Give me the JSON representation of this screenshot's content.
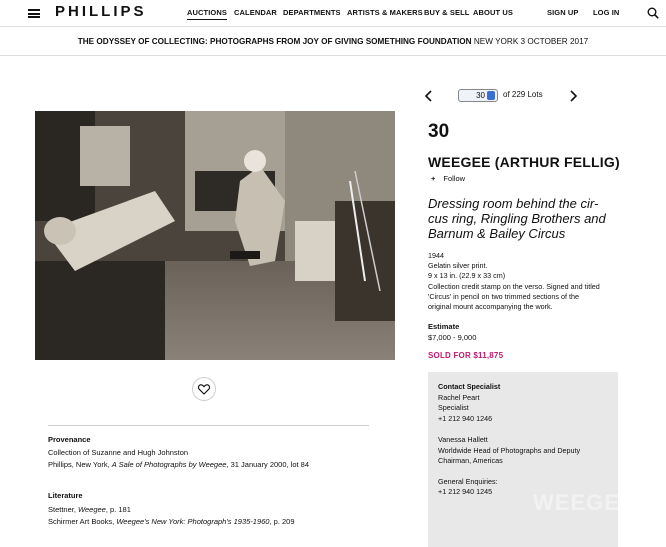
{
  "nav": {
    "logo": "PHILLIPS",
    "links": [
      "AUCTIONS",
      "CALENDAR",
      "DEPARTMENTS",
      "ARTISTS & MAKERS",
      "BUY & SELL",
      "ABOUT US"
    ],
    "sign_up": "SIGN UP",
    "log_in": "LOG IN"
  },
  "sale": {
    "title": "THE ODYSSEY OF COLLECTING: PHOTOGRAPHS FROM JOY OF GIVING SOMETHING FOUNDATION",
    "location_date": "NEW YORK 3 OCTOBER 2017"
  },
  "lot_nav": {
    "current": "30",
    "of_total": "of 229 Lots"
  },
  "lot": {
    "number": "30",
    "artist": "WEEGEE (ARTHUR FELLIG)",
    "follow": "Follow",
    "title_lines": [
      "Dressing room behind the cir-",
      "cus ring, Ringling Brothers and",
      "Barnum & Bailey Circus"
    ],
    "details": [
      "1944",
      "Gelatin silver print.",
      "9 x 13 in. (22.9 x 33 cm)",
      "Collection credit stamp on the verso. Signed and titled",
      "'Circus' in pencil on two trimmed sections of the",
      "original mount accompanying the work."
    ],
    "estimate_label": "Estimate",
    "estimate": "$7,000 - 9,000",
    "sold": "SOLD FOR $11,875"
  },
  "contact": {
    "heading": "Contact Specialist",
    "name1": "Rachel Peart",
    "role1": "Specialist",
    "phone1": "+1 212 940 1246",
    "name2": "Vanessa Hallett",
    "role2a": "Worldwide Head of Photographs and Deputy",
    "role2b": "Chairman, Americas",
    "general": "General Enquiries:",
    "general_phone": "+1 212 940 1245",
    "watermark": "WEEGEE"
  },
  "provenance": {
    "heading": "Provenance",
    "line1": "Collection of Suzanne and Hugh Johnston",
    "line2_pre": "Phillips, New York, ",
    "line2_em": "A Sale of Photographs by Weegee",
    "line2_post": ", 31 January 2000, lot 84"
  },
  "literature": {
    "heading": "Literature",
    "line1_pre": "Stettner, ",
    "line1_em": "Weegee",
    "line1_post": ", p. 181",
    "line2_pre": "Schirmer Art Books, ",
    "line2_em": "Weegee's New York: Photograph's 1935-1960",
    "line2_post": ", p. 209"
  },
  "icons": {
    "menu": "hamburger-menu-icon",
    "search": "search-icon",
    "prev": "chevron-left-icon",
    "next": "chevron-right-icon",
    "favorite": "heart-icon"
  }
}
